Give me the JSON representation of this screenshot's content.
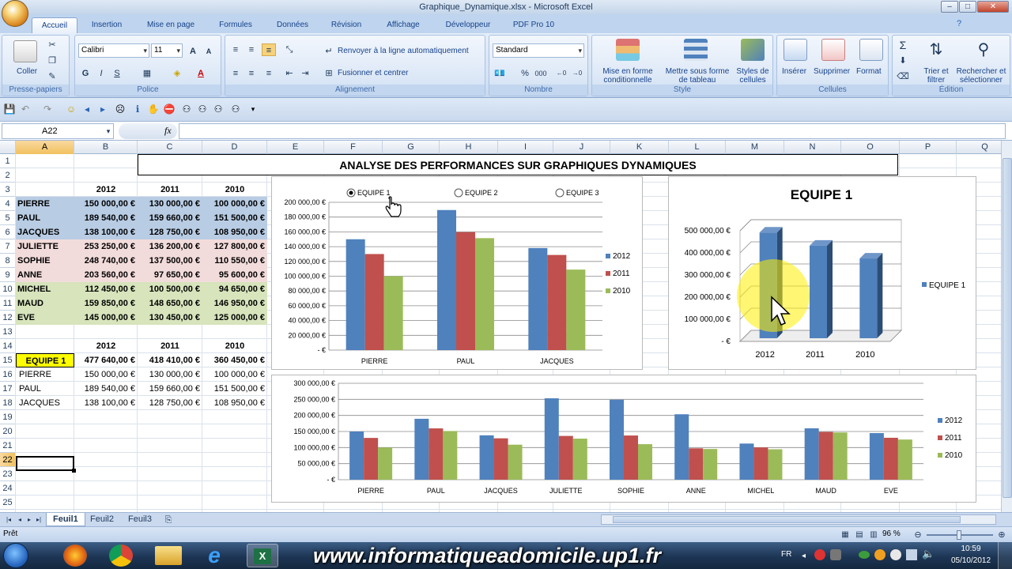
{
  "window": {
    "title": "Graphique_Dynamique.xlsx - Microsoft Excel"
  },
  "ribbon": {
    "tabs": [
      "Accueil",
      "Insertion",
      "Mise en page",
      "Formules",
      "Données",
      "Révision",
      "Affichage",
      "Développeur",
      "PDF Pro 10"
    ],
    "clipboard": {
      "paste": "Coller",
      "label": "Presse-papiers"
    },
    "font": {
      "name": "Calibri",
      "size": "11",
      "label": "Police"
    },
    "alignment": {
      "wrap": "Renvoyer à la ligne automatiquement",
      "merge": "Fusionner et centrer",
      "label": "Alignement"
    },
    "number": {
      "format": "Standard",
      "label": "Nombre"
    },
    "style": {
      "cond": "Mise en forme conditionnelle",
      "table": "Mettre sous forme de tableau",
      "cell": "Styles de cellules",
      "label": "Style"
    },
    "cells": {
      "insert": "Insérer",
      "delete": "Supprimer",
      "format": "Format",
      "label": "Cellules"
    },
    "editing": {
      "sort": "Trier et filtrer",
      "find": "Rechercher et sélectionner",
      "label": "Édition"
    }
  },
  "formula_bar": {
    "namebox": "A22",
    "fx": "fx",
    "value": ""
  },
  "columns": [
    "A",
    "B",
    "C",
    "D",
    "E",
    "F",
    "G",
    "H",
    "I",
    "J",
    "K",
    "L",
    "M",
    "N",
    "O",
    "P",
    "Q"
  ],
  "rows": [
    "1",
    "2",
    "3",
    "4",
    "5",
    "6",
    "7",
    "8",
    "9",
    "10",
    "11",
    "12",
    "13",
    "14",
    "15",
    "16",
    "17",
    "18",
    "19",
    "20",
    "21",
    "22",
    "23",
    "24",
    "25"
  ],
  "sheet": {
    "title": "ANALYSE DES PERFORMANCES SUR GRAPHIQUES DYNAMIQUES",
    "years": [
      "2012",
      "2011",
      "2010"
    ],
    "table1": [
      {
        "name": "PIERRE",
        "v2012": "150 000,00 €",
        "v2011": "130 000,00 €",
        "v2010": "100 000,00 €"
      },
      {
        "name": "PAUL",
        "v2012": "189 540,00 €",
        "v2011": "159 660,00 €",
        "v2010": "151 500,00 €"
      },
      {
        "name": "JACQUES",
        "v2012": "138 100,00 €",
        "v2011": "128 750,00 €",
        "v2010": "108 950,00 €"
      },
      {
        "name": "JULIETTE",
        "v2012": "253 250,00 €",
        "v2011": "136 200,00 €",
        "v2010": "127 800,00 €"
      },
      {
        "name": "SOPHIE",
        "v2012": "248 740,00 €",
        "v2011": "137 500,00 €",
        "v2010": "110 550,00 €"
      },
      {
        "name": "ANNE",
        "v2012": "203 560,00 €",
        "v2011": "97 650,00 €",
        "v2010": "95 600,00 €"
      },
      {
        "name": "MICHEL",
        "v2012": "112 450,00 €",
        "v2011": "100 500,00 €",
        "v2010": "94 650,00 €"
      },
      {
        "name": "MAUD",
        "v2012": "159 850,00 €",
        "v2011": "148 650,00 €",
        "v2010": "146 950,00 €"
      },
      {
        "name": "EVE",
        "v2012": "145 000,00 €",
        "v2011": "130 450,00 €",
        "v2010": "125 000,00 €"
      }
    ],
    "total": {
      "name": "EQUIPE 1",
      "v2012": "477 640,00 €",
      "v2011": "418 410,00 €",
      "v2010": "360 450,00 €"
    },
    "table2": [
      {
        "name": "PIERRE",
        "v2012": "150 000,00 €",
        "v2011": "130 000,00 €",
        "v2010": "100 000,00 €"
      },
      {
        "name": "PAUL",
        "v2012": "189 540,00 €",
        "v2011": "159 660,00 €",
        "v2010": "151 500,00 €"
      },
      {
        "name": "JACQUES",
        "v2012": "138 100,00 €",
        "v2011": "128 750,00 €",
        "v2010": "108 950,00 €"
      }
    ]
  },
  "colors": {
    "s2012": "#4f81bd",
    "s2011": "#c0504d",
    "s2010": "#9bbb59",
    "blueFill": "#b8cce4",
    "pinkFill": "#f2dcdb",
    "greenFill": "#d7e4bc",
    "yellow": "#ffff00"
  },
  "chart_data": [
    {
      "type": "bar",
      "options": [
        "EQUIPE 1",
        "EQUIPE 2",
        "EQUIPE 3"
      ],
      "selected": "EQUIPE 1",
      "categories": [
        "PIERRE",
        "PAUL",
        "JACQUES"
      ],
      "series": [
        {
          "name": "2012",
          "values": [
            150000,
            189540,
            138100
          ]
        },
        {
          "name": "2011",
          "values": [
            130000,
            159660,
            128750
          ]
        },
        {
          "name": "2010",
          "values": [
            100000,
            151500,
            108950
          ]
        }
      ],
      "ylim": [
        0,
        200000
      ],
      "yticks": [
        "200 000,00 €",
        "180 000,00 €",
        "160 000,00 €",
        "140 000,00 €",
        "120 000,00 €",
        "100 000,00 €",
        "80 000,00 €",
        "60 000,00 €",
        "40 000,00 €",
        "20 000,00 €",
        "- €"
      ],
      "legend": "right"
    },
    {
      "type": "bar",
      "title": "EQUIPE 1",
      "categories": [
        "2012",
        "2011",
        "2010"
      ],
      "series": [
        {
          "name": "EQUIPE 1",
          "values": [
            477640,
            418410,
            360450
          ]
        }
      ],
      "ylim": [
        0,
        500000
      ],
      "yticks": [
        "500 000,00 €",
        "400 000,00 €",
        "300 000,00 €",
        "200 000,00 €",
        "100 000,00 €",
        "- €"
      ],
      "legend": "right"
    },
    {
      "type": "bar",
      "categories": [
        "PIERRE",
        "PAUL",
        "JACQUES",
        "JULIETTE",
        "SOPHIE",
        "ANNE",
        "MICHEL",
        "MAUD",
        "EVE"
      ],
      "series": [
        {
          "name": "2012",
          "values": [
            150000,
            189540,
            138100,
            253250,
            248740,
            203560,
            112450,
            159850,
            145000
          ]
        },
        {
          "name": "2011",
          "values": [
            130000,
            159660,
            128750,
            136200,
            137500,
            97650,
            100500,
            148650,
            130450
          ]
        },
        {
          "name": "2010",
          "values": [
            100000,
            151500,
            108950,
            127800,
            110550,
            95600,
            94650,
            146950,
            125000
          ]
        }
      ],
      "ylim": [
        0,
        300000
      ],
      "yticks": [
        "300 000,00 €",
        "250 000,00 €",
        "200 000,00 €",
        "150 000,00 €",
        "100 000,00 €",
        "50 000,00 €",
        "- €"
      ],
      "legend": "right"
    }
  ],
  "sheet_tabs": [
    "Feuil1",
    "Feuil2",
    "Feuil3"
  ],
  "status": {
    "left": "Prêt",
    "zoom": "96 %"
  },
  "taskbar": {
    "watermark": "www.informatiqueadomicile.up1.fr",
    "lang": "FR",
    "time": "10:59",
    "date": "05/10/2012"
  }
}
